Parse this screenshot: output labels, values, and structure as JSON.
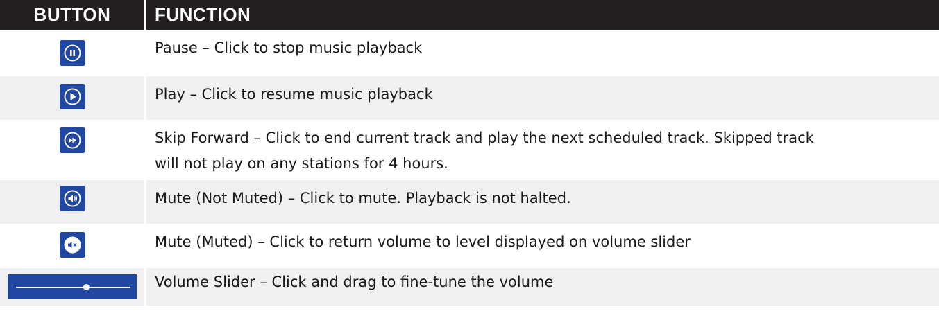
{
  "header": {
    "button": "BUTTON",
    "function": "FUNCTION"
  },
  "colors": {
    "button_blue": "#2247a0",
    "header_bg": "#231f20",
    "stripe": "#f0f0f0"
  },
  "rows": [
    {
      "icon": "pause-icon",
      "text": "Pause – Click to stop music playback"
    },
    {
      "icon": "play-icon",
      "text": "Play – Click to resume music playback"
    },
    {
      "icon": "skip-forward-icon",
      "text_line1": "Skip Forward – Click to end current track and play the next scheduled track. Skipped track",
      "text_line2": "will not play on any stations for 4 hours."
    },
    {
      "icon": "volume-icon",
      "text": "Mute (Not Muted) – Click to mute. Playback is not halted."
    },
    {
      "icon": "muted-icon",
      "text": "Mute (Muted) – Click to return volume to level displayed on volume slider"
    },
    {
      "icon": "volume-slider",
      "text": "Volume Slider – Click and drag to fine-tune the volume",
      "level": 0.62
    }
  ]
}
